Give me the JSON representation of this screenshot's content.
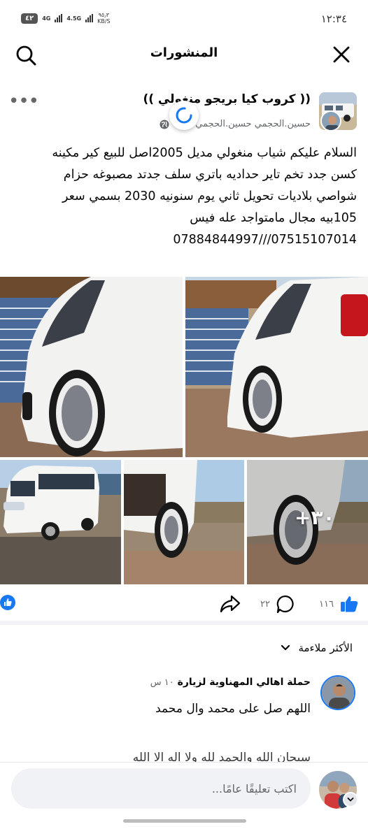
{
  "status_bar": {
    "time": "١٢:٣٤",
    "battery": "٤٢",
    "network_1": "4G",
    "network_2": "4.5G",
    "speed_value": "٩٥٫٣",
    "speed_unit": "KB/S"
  },
  "top_bar": {
    "title": "المنشورات",
    "icons": {
      "close": "close-icon",
      "search": "search-icon"
    }
  },
  "post": {
    "group_name": "(( كروب كيا بريجو منغولي ))",
    "author": "حسين.الحجمي حسين.الحجمي",
    "time": "س ٠",
    "text_lines": [
      "السلام عليكم شياب منغولي مديل 2005اصل للبيع كير مكينه",
      "كسن جدد تخم تاير حداديه  باتري سلف جدتد مصبوغه حزام",
      "شواصي بلاديات تحويل ثاني يوم سنونيه 2030 بسمي سعر",
      "105بيه مجال مامتواجد عله فيس",
      "07515107014///07884844997"
    ],
    "more_photos": "+٣٠",
    "like_count": "١١٦",
    "comment_count": "٢٢"
  },
  "comments": {
    "sort_label": "الأكثر ملاءمة",
    "items": [
      {
        "author": "حملة اهالي المهناوية لزيارة",
        "time": "١٠ س",
        "text": "اللهم صل على محمد وال محمد"
      }
    ],
    "partial_next": "سبحان الله والحمد لله ولا اله الا الله"
  },
  "composer": {
    "placeholder": "اكتب تعليقًا عامًا..."
  },
  "colors": {
    "accent": "#1877f2",
    "secondary_text": "#65676b",
    "divider": "#f0f2f5"
  }
}
